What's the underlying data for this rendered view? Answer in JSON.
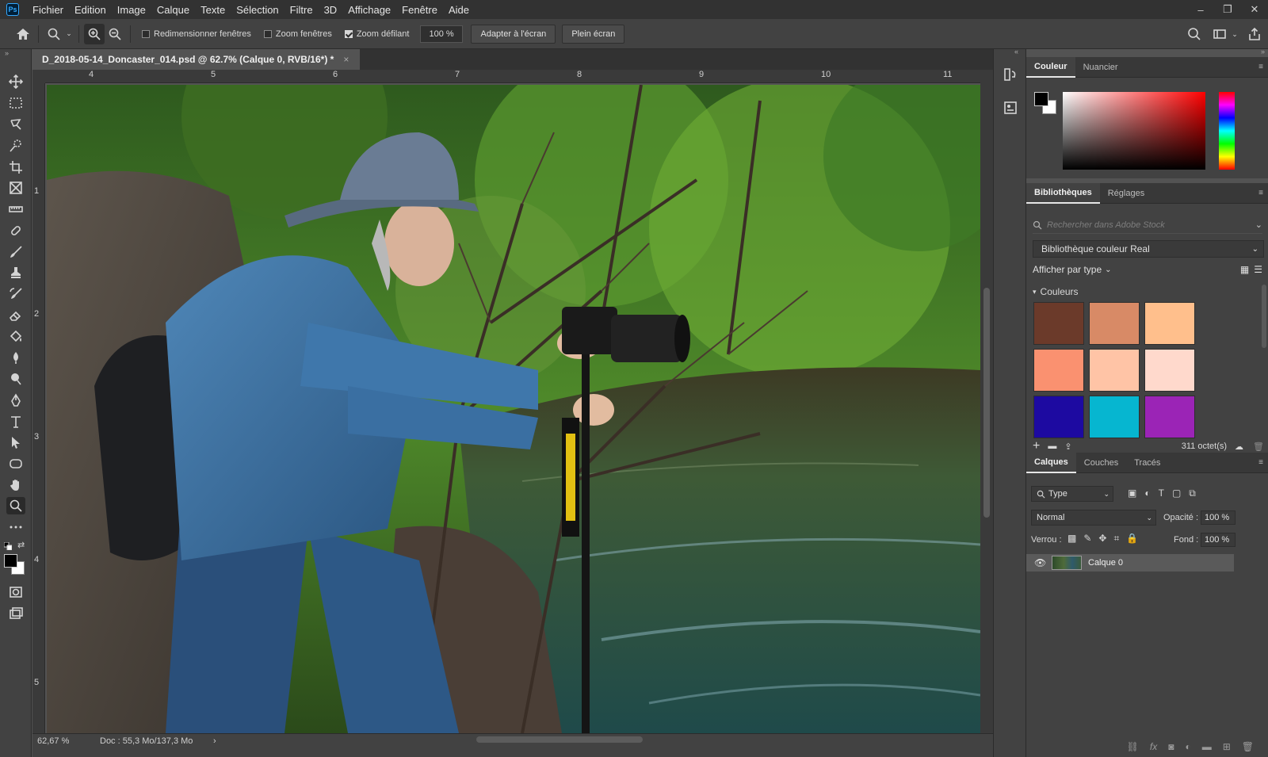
{
  "app": {
    "logo": "Ps"
  },
  "menu": [
    "Fichier",
    "Edition",
    "Image",
    "Calque",
    "Texte",
    "Sélection",
    "Filtre",
    "3D",
    "Affichage",
    "Fenêtre",
    "Aide"
  ],
  "window_controls": {
    "minimize": "–",
    "restore": "❐",
    "close": "✕"
  },
  "options": {
    "resize_windows": "Redimensionner fenêtres",
    "zoom_windows": "Zoom fenêtres",
    "scrubby_zoom": "Zoom défilant",
    "zoom_value": "100 %",
    "fit_screen": "Adapter à l'écran",
    "full_screen": "Plein écran"
  },
  "document": {
    "tab_title": "D_2018-05-14_Doncaster_014.psd @ 62.7% (Calque 0, RVB/16*) *",
    "tab_close": "×"
  },
  "rulers": {
    "top": [
      "4",
      "5",
      "6",
      "7",
      "8",
      "9",
      "10",
      "11"
    ],
    "left": [
      "1",
      "2",
      "3",
      "4",
      "5"
    ]
  },
  "status": {
    "zoom": "62,67 %",
    "doc": "Doc : 55,3 Mo/137,3 Mo",
    "arrow": "›"
  },
  "color_panel": {
    "tabs": [
      "Couleur",
      "Nuancier"
    ]
  },
  "libraries_panel": {
    "tabs": [
      "Bibliothèques",
      "Réglages"
    ],
    "search_placeholder": "Rechercher dans Adobe Stock",
    "library_name": "Bibliothèque couleur Real",
    "view_by": "Afficher par type",
    "group": "Couleurs",
    "swatches": [
      "#6b3a2a",
      "#d88a66",
      "#ffbf8c",
      "#fa9170",
      "#ffc4a6",
      "#ffd9cc",
      "#1d0aa1",
      "#06b6d0",
      "#9b24b6"
    ],
    "size": "311 octet(s)"
  },
  "layers_panel": {
    "tabs": [
      "Calques",
      "Couches",
      "Tracés"
    ],
    "filter": "Type",
    "blend_mode": "Normal",
    "opacity_label": "Opacité :",
    "opacity": "100 %",
    "lock_label": "Verrou :",
    "fill_label": "Fond :",
    "fill": "100 %",
    "layers": [
      {
        "name": "Calque 0",
        "visible": true
      }
    ],
    "footer_icons": [
      "link-icon",
      "fx-icon",
      "mask-icon",
      "adjustment-icon",
      "group-icon",
      "new-layer-icon",
      "trash-icon"
    ]
  },
  "toolbar_tools": [
    "move-tool-icon",
    "marquee-tool-icon",
    "lasso-tool-icon",
    "quick-select-tool-icon",
    "crop-tool-icon",
    "frame-tool-icon",
    "ruler-tool-icon",
    "healing-tool-icon",
    "brush-tool-icon",
    "stamp-tool-icon",
    "history-brush-tool-icon",
    "eraser-tool-icon",
    "bucket-tool-icon",
    "blur-tool-icon",
    "dodge-tool-icon",
    "pen-tool-icon",
    "type-tool-icon",
    "path-select-tool-icon",
    "shape-tool-icon",
    "hand-tool-icon",
    "zoom-tool-icon",
    "more-tools-icon"
  ]
}
